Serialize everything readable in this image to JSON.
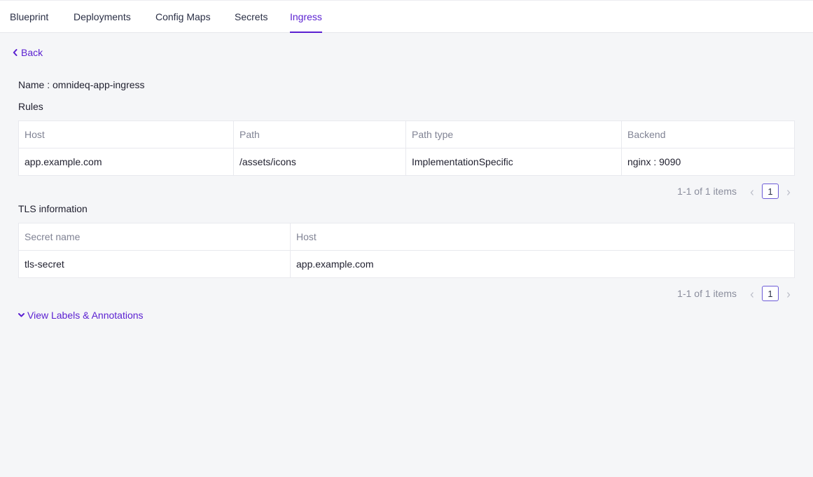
{
  "tabs": [
    {
      "label": "Blueprint",
      "active": false
    },
    {
      "label": "Deployments",
      "active": false
    },
    {
      "label": "Config Maps",
      "active": false
    },
    {
      "label": "Secrets",
      "active": false
    },
    {
      "label": "Ingress",
      "active": true
    }
  ],
  "back_label": "Back",
  "name_line": "Name : omnideq-app-ingress",
  "rules": {
    "title": "Rules",
    "columns": [
      "Host",
      "Path",
      "Path type",
      "Backend"
    ],
    "rows": [
      [
        "app.example.com",
        "/assets/icons",
        "ImplementationSpecific",
        "nginx : 9090"
      ]
    ],
    "pagination": {
      "summary": "1-1 of 1 items",
      "current_page": "1"
    }
  },
  "tls": {
    "title": "TLS information",
    "columns": [
      "Secret name",
      "Host"
    ],
    "rows": [
      [
        "tls-secret",
        "app.example.com"
      ]
    ],
    "pagination": {
      "summary": "1-1 of 1 items",
      "current_page": "1"
    }
  },
  "labels_toggle": "View Labels & Annotations",
  "colors": {
    "accent": "#5a1fd1",
    "background": "#f5f6f8"
  },
  "icons": {
    "back": "chevron-left-icon",
    "prev": "chevron-left-icon",
    "next": "chevron-right-icon",
    "expand": "chevron-down-icon"
  }
}
